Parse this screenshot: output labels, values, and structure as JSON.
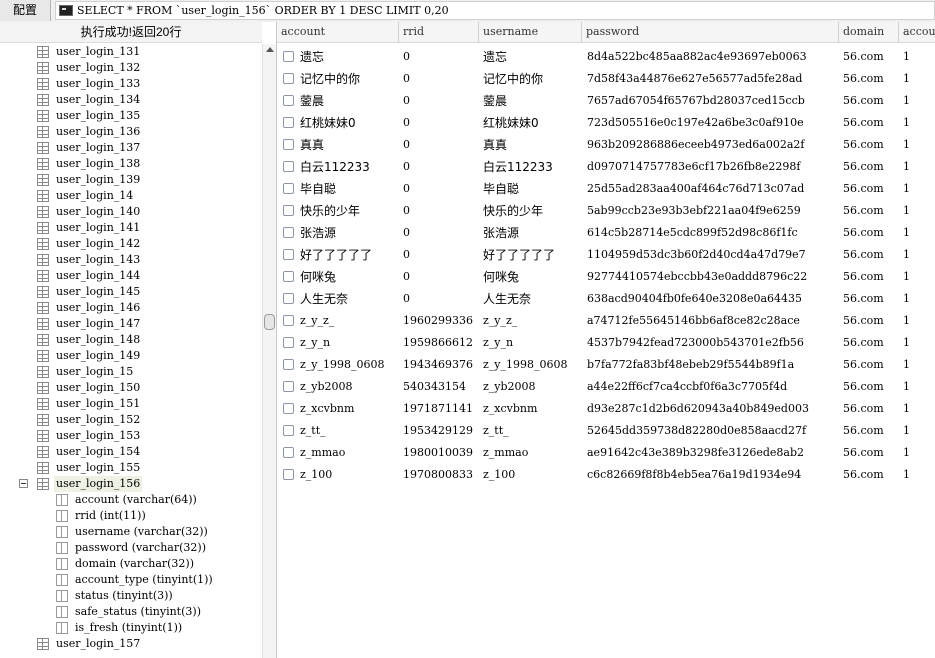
{
  "toolbar": {
    "config_label": "配置",
    "query": "SELECT * FROM `user_login_156` ORDER BY 1 DESC LIMIT 0,20"
  },
  "status_text": "执行成功!返回20行",
  "tree": {
    "tables_before": [
      "user_login_131",
      "user_login_132",
      "user_login_133",
      "user_login_134",
      "user_login_135",
      "user_login_136",
      "user_login_137",
      "user_login_138",
      "user_login_139",
      "user_login_14",
      "user_login_140",
      "user_login_141",
      "user_login_142",
      "user_login_143",
      "user_login_144",
      "user_login_145",
      "user_login_146",
      "user_login_147",
      "user_login_148",
      "user_login_149",
      "user_login_15",
      "user_login_150",
      "user_login_151",
      "user_login_152",
      "user_login_153",
      "user_login_154",
      "user_login_155"
    ],
    "expanded_table": "user_login_156",
    "columns": [
      "account (varchar(64))",
      "rrid (int(11))",
      "username (varchar(32))",
      "password (varchar(32))",
      "domain (varchar(32))",
      "account_type (tinyint(1))",
      "status (tinyint(3))",
      "safe_status (tinyint(3))",
      "is_fresh (tinyint(1))"
    ],
    "tables_after": [
      "user_login_157"
    ]
  },
  "grid": {
    "headers": [
      "account",
      "rrid",
      "username",
      "password",
      "domain",
      "accou"
    ],
    "rows": [
      {
        "account": "遗忘",
        "rrid": "0",
        "username": "遗忘",
        "password": "8d4a522bc485aa882ac4e93697eb0063",
        "domain": "56.com",
        "account_type": "1"
      },
      {
        "account": "记忆中的你",
        "rrid": "0",
        "username": "记忆中的你",
        "password": "7d58f43a44876e627e56577ad5fe28ad",
        "domain": "56.com",
        "account_type": "1"
      },
      {
        "account": "蓥晨",
        "rrid": "0",
        "username": "蓥晨",
        "password": "7657ad67054f65767bd28037ced15ccb",
        "domain": "56.com",
        "account_type": "1"
      },
      {
        "account": "红桃妹妹0",
        "rrid": "0",
        "username": "红桃妹妹0",
        "password": "723d505516e0c197e42a6be3c0af910e",
        "domain": "56.com",
        "account_type": "1"
      },
      {
        "account": "真真",
        "rrid": "0",
        "username": "真真",
        "password": "963b209286886eceeb4973ed6a002a2f",
        "domain": "56.com",
        "account_type": "1"
      },
      {
        "account": "白云112233",
        "rrid": "0",
        "username": "白云112233",
        "password": "d0970714757783e6cf17b26fb8e2298f",
        "domain": "56.com",
        "account_type": "1"
      },
      {
        "account": "毕自聪",
        "rrid": "0",
        "username": "毕自聪",
        "password": "25d55ad283aa400af464c76d713c07ad",
        "domain": "56.com",
        "account_type": "1"
      },
      {
        "account": "快乐的少年",
        "rrid": "0",
        "username": "快乐的少年",
        "password": "5ab99ccb23e93b3ebf221aa04f9e6259",
        "domain": "56.com",
        "account_type": "1"
      },
      {
        "account": "张浩源",
        "rrid": "0",
        "username": "张浩源",
        "password": "614c5b28714e5cdc899f52d98c86f1fc",
        "domain": "56.com",
        "account_type": "1"
      },
      {
        "account": "好了了了了了",
        "rrid": "0",
        "username": "好了了了了了",
        "password": "1104959d53dc3b60f2d40cd4a47d79e7",
        "domain": "56.com",
        "account_type": "1"
      },
      {
        "account": "何咪兔",
        "rrid": "0",
        "username": "何咪兔",
        "password": "92774410574ebccbb43e0addd8796c22",
        "domain": "56.com",
        "account_type": "1"
      },
      {
        "account": "人生无奈",
        "rrid": "0",
        "username": "人生无奈",
        "password": "638acd90404fb0fe640e3208e0a64435",
        "domain": "56.com",
        "account_type": "1"
      },
      {
        "account": "z_y_z_",
        "rrid": "1960299336",
        "username": "z_y_z_",
        "password": "a74712fe55645146bb6af8ce82c28ace",
        "domain": "56.com",
        "account_type": "1"
      },
      {
        "account": "z_y_n",
        "rrid": "1959866612",
        "username": "z_y_n",
        "password": "4537b7942fead723000b543701e2fb56",
        "domain": "56.com",
        "account_type": "1"
      },
      {
        "account": "z_y_1998_0608",
        "rrid": "1943469376",
        "username": "z_y_1998_0608",
        "password": "b7fa772fa83bf48ebeb29f5544b89f1a",
        "domain": "56.com",
        "account_type": "1"
      },
      {
        "account": "z_yb2008",
        "rrid": "540343154",
        "username": "z_yb2008",
        "password": "a44e22ff6cf7ca4ccbf0f6a3c7705f4d",
        "domain": "56.com",
        "account_type": "1"
      },
      {
        "account": "z_xcvbnm",
        "rrid": "1971871141",
        "username": "z_xcvbnm",
        "password": "d93e287c1d2b6d620943a40b849ed003",
        "domain": "56.com",
        "account_type": "1"
      },
      {
        "account": "z_tt_",
        "rrid": "1953429129",
        "username": "z_tt_",
        "password": "52645dd359738d82280d0e858aacd27f",
        "domain": "56.com",
        "account_type": "1"
      },
      {
        "account": "z_mmao",
        "rrid": "1980010039",
        "username": "z_mmao",
        "password": "ae91642c43e389b3298fe3126ede8ab2",
        "domain": "56.com",
        "account_type": "1"
      },
      {
        "account": "z_100",
        "rrid": "1970800833",
        "username": "z_100",
        "password": "c6c82669f8f8b4eb5ea76a19d1934e94",
        "domain": "56.com",
        "account_type": "1"
      }
    ]
  },
  "colors": {
    "selected_bg": "#eef2e4",
    "header_bg": "#f5f5f5",
    "border": "#d0d0d0"
  }
}
